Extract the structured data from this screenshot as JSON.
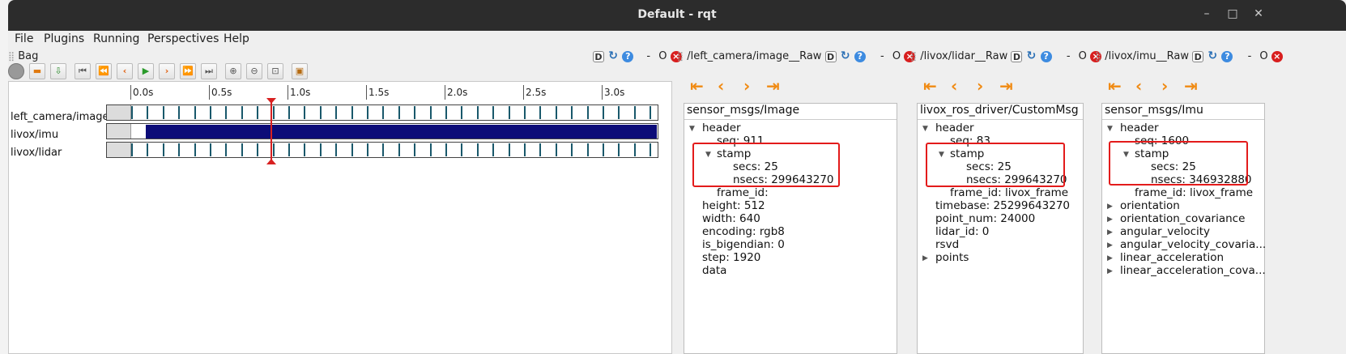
{
  "window": {
    "title": "Default - rqt"
  },
  "menu": [
    {
      "label": "File"
    },
    {
      "label": "Plugins"
    },
    {
      "label": "Running"
    },
    {
      "label": "Perspectives"
    },
    {
      "label": "Help"
    }
  ],
  "bag": {
    "title": "Bag",
    "ticks": [
      "0.0s",
      "0.5s",
      "1.0s",
      "1.5s",
      "2.0s",
      "2.5s",
      "3.0s"
    ],
    "topics": [
      "left_camera/image",
      "livox/imu",
      "livox/lidar"
    ]
  },
  "docks": [
    {
      "title": "/left_camera/image__Raw"
    },
    {
      "title": "/livox/lidar__Raw"
    },
    {
      "title": "/livox/imu__Raw"
    }
  ],
  "dock_buttons": {
    "d": "D",
    "o": "O",
    "dash": "-"
  },
  "panels": {
    "image": {
      "type": "sensor_msgs/Image",
      "rows": [
        "header",
        "seq:  911",
        "stamp",
        "secs:  25",
        "nsecs:  299643270",
        "frame_id:",
        "height:  512",
        "width:  640",
        "encoding: rgb8",
        "is_bigendian:  0",
        "step:  1920",
        "data"
      ]
    },
    "lidar": {
      "type": "livox_ros_driver/CustomMsg",
      "rows": [
        "header",
        "seq:  83",
        "stamp",
        "secs:  25",
        "nsecs:  299643270",
        "frame_id: livox_frame",
        "timebase:  25299643270",
        "point_num:  24000",
        "lidar_id:  0",
        "rsvd",
        "points"
      ]
    },
    "imu": {
      "type": "sensor_msgs/Imu",
      "rows": [
        "header",
        "seq:  1600",
        "stamp",
        "secs:  25",
        "nsecs:  346932880",
        "frame_id: livox_frame",
        "orientation",
        "orientation_covariance",
        "angular_velocity",
        "angular_velocity_covaria...",
        "linear_acceleration",
        "linear_acceleration_cova..."
      ]
    }
  },
  "accent": {
    "highlight": "#e31b1b",
    "imu_track": "#0c0c78",
    "nav": "#f08a12"
  }
}
